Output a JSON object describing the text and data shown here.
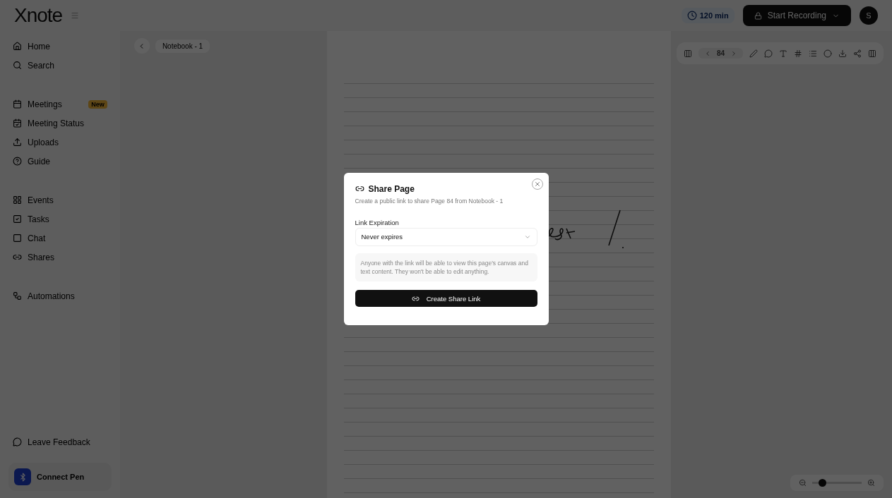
{
  "app": {
    "logo": "Xnote",
    "usage": "120 min",
    "record_button": "Start Recording",
    "avatar": "S"
  },
  "sidebar": {
    "items": [
      {
        "label": "Home"
      },
      {
        "label": "Search"
      },
      {
        "label": "Meetings",
        "badge": "New"
      },
      {
        "label": "Meeting Status"
      },
      {
        "label": "Uploads"
      },
      {
        "label": "Guide"
      },
      {
        "label": "Events"
      },
      {
        "label": "Tasks"
      },
      {
        "label": "Chat"
      },
      {
        "label": "Shares"
      },
      {
        "label": "Automations"
      }
    ],
    "feedback": "Leave Feedback",
    "pen": {
      "title": "Connect Pen"
    }
  },
  "breadcrumb": {
    "notebook": "Notebook - 1"
  },
  "toolbar": {
    "page": "84"
  },
  "zoom": {
    "level": 0.2
  },
  "dialog": {
    "title": "Share Page",
    "subtitle": "Create a public link to share Page 84 from Notebook - 1",
    "field_label": "Link Expiration",
    "select_value": "Never expires",
    "info": "Anyone with the link will be able to view this page's canvas and text content. They won't be able to edit anything.",
    "button": "Create Share Link"
  }
}
